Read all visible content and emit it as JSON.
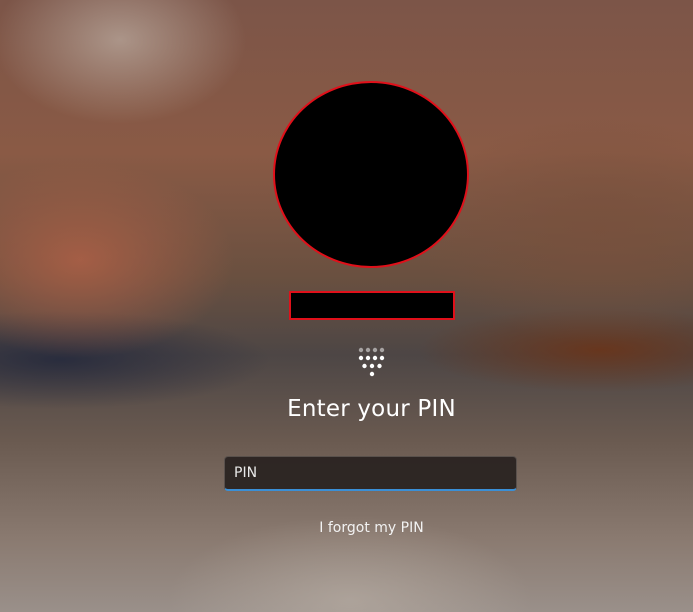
{
  "login": {
    "title": "Enter your PIN",
    "pin_input": {
      "value": "",
      "placeholder": "PIN"
    },
    "forgot_link": "I forgot my PIN",
    "icon": "keypad-icon"
  },
  "colors": {
    "redaction_border": "#e0101a",
    "input_focus_accent": "#3a8fd6"
  }
}
